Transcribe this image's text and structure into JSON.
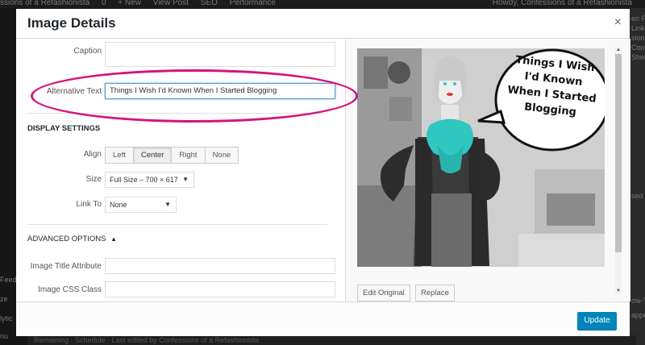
{
  "background": {
    "admin_bar": {
      "site_name": "ssions of a Refashionista",
      "comments_count": "0",
      "new_label": "+ New",
      "view_post": "View Post",
      "seo": "SEO",
      "performance": "Performance",
      "howdy": "Howdy, Confessions of a Refashionista"
    },
    "left_menu": [
      "Feed",
      "ze",
      "lytic",
      "nu"
    ],
    "right_snippets": [
      "eri Pav",
      "Linke",
      "sions",
      "Confe",
      "Sherl",
      "sed",
      "ow-T",
      "apper"
    ],
    "bottom_text": "Remaining  ·  Schedule  ·  Last edited by Confessions of a Refashionista"
  },
  "modal": {
    "title": "Image Details",
    "close_glyph": "×",
    "fields": {
      "caption_label": "Caption",
      "caption_value": "",
      "alt_label": "Alternative Text",
      "alt_value": "Things I Wish I'd Known When I Started Blogging"
    },
    "display_settings": {
      "heading": "DISPLAY SETTINGS",
      "align_label": "Align",
      "align_options": [
        "Left",
        "Center",
        "Right",
        "None"
      ],
      "align_selected": "Center",
      "size_label": "Size",
      "size_value": "Full Size – 700 × 617",
      "link_label": "Link To",
      "link_value": "None"
    },
    "advanced_options": {
      "heading": "ADVANCED OPTIONS",
      "title_attr_label": "Image Title Attribute",
      "title_attr_value": "",
      "css_class_label": "Image CSS Class",
      "css_class_value": ""
    },
    "image": {
      "caption_bubble": "Things I Wish I'd Known When I Started Blogging",
      "edit_original": "Edit Original",
      "replace": "Replace"
    },
    "update_button": "Update"
  },
  "colors": {
    "highlight": "#d4147c",
    "primary_button": "#0085ba",
    "scarf": "#2fc7c0"
  }
}
